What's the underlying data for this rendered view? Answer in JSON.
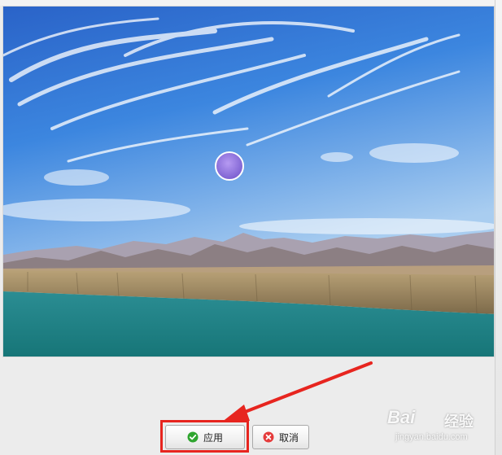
{
  "preview": {
    "image_description": "landscape-photo",
    "marker_color": "#8a6bd6"
  },
  "actions": {
    "apply_label": "应用",
    "cancel_label": "取消"
  },
  "annotation": {
    "highlight_color": "#e7251f"
  },
  "watermark": {
    "brand": "Bai",
    "brand_suffix": "经验",
    "url": "jingyan.baidu.com"
  },
  "icons": {
    "apply": "check-circle-icon",
    "cancel": "x-circle-icon"
  }
}
